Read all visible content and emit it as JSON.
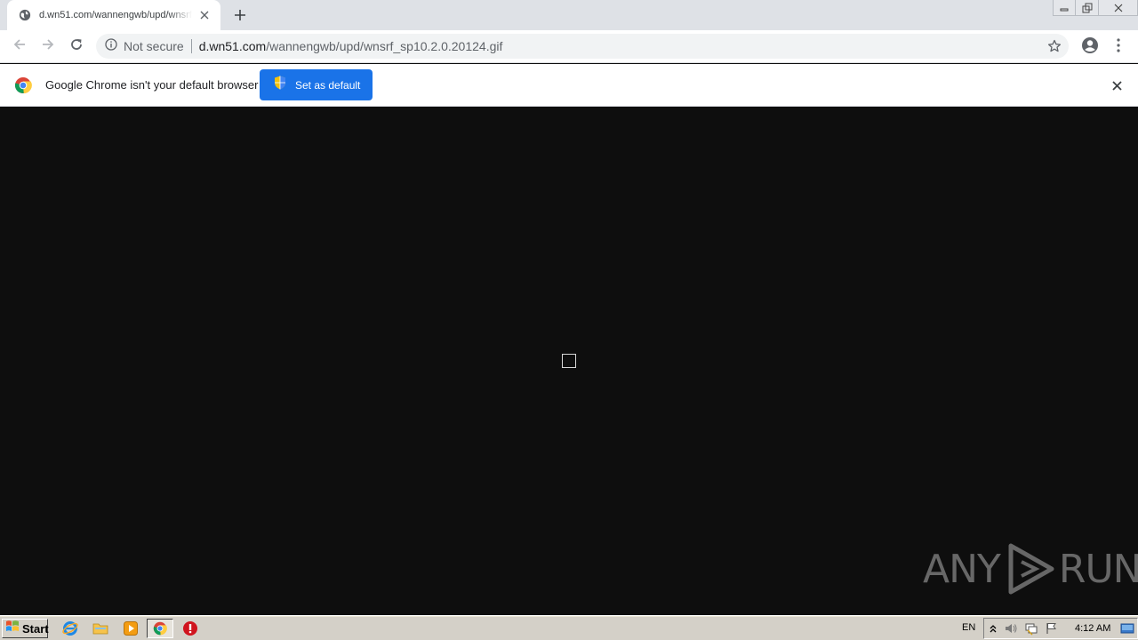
{
  "browser": {
    "tab": {
      "title": "d.wn51.com/wannengwb/upd/wnsrf_sp10.2.0.20124.gif",
      "favicon": "globe-icon"
    },
    "address_bar": {
      "security_label": "Not secure",
      "url_host": "d.wn51.com",
      "url_path": "/wannengwb/upd/wnsrf_sp10.2.0.20124.gif"
    },
    "icons": {
      "back": "arrow-left-icon",
      "forward": "arrow-right-icon",
      "reload": "reload-icon",
      "bookmark": "star-icon",
      "profile": "account-icon",
      "menu": "more-vert-icon"
    }
  },
  "infobar": {
    "message": "Google Chrome isn't your default browser",
    "button_label": "Set as default"
  },
  "content": {
    "background": "#0e0e0e",
    "watermark_text_left": "ANY",
    "watermark_text_right": "RUN"
  },
  "taskbar": {
    "start_label": "Start",
    "language": "EN",
    "clock": "4:12 AM",
    "pinned": [
      "internet-explorer-icon",
      "folder-icon",
      "media-player-icon",
      "chrome-icon",
      "stop-icon"
    ]
  },
  "colors": {
    "accent": "#1a73e8",
    "tabstrip": "#dee1e6",
    "taskbar": "#d4d0c8"
  }
}
